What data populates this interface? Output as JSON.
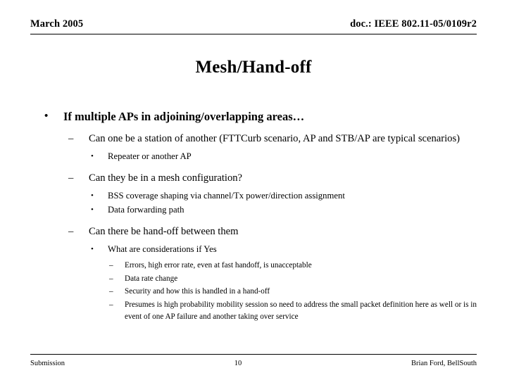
{
  "header": {
    "date": "March 2005",
    "doc_ref": "doc.: IEEE 802.11-05/0109r2"
  },
  "title": "Mesh/Hand-off",
  "bullets": {
    "l1_a": "If multiple APs in adjoining/overlapping areas…",
    "l2_a": "Can one be a station of another (FTTCurb scenario, AP and STB/AP are typical scenarios)",
    "l3_a": "Repeater or another AP",
    "l2_b": "Can they be in a mesh configuration?",
    "l3_b": "BSS coverage shaping via channel/Tx power/direction assignment",
    "l3_c": "Data forwarding path",
    "l2_c": "Can there be hand-off between them",
    "l3_d": "What are considerations if Yes",
    "l4_a": "Errors, high error rate, even at fast handoff, is unacceptable",
    "l4_b": "Data rate change",
    "l4_c": "Security and how this is handled in a hand-off",
    "l4_d": "Presumes is high probability mobility session so need to address the small packet definition here as well or is in event of one AP failure and another taking over service"
  },
  "markers": {
    "level1": "•",
    "level2": "–",
    "level3": "•",
    "level4": "–"
  },
  "footer": {
    "left": "Submission",
    "page": "10",
    "right": "Brian Ford, BellSouth"
  }
}
